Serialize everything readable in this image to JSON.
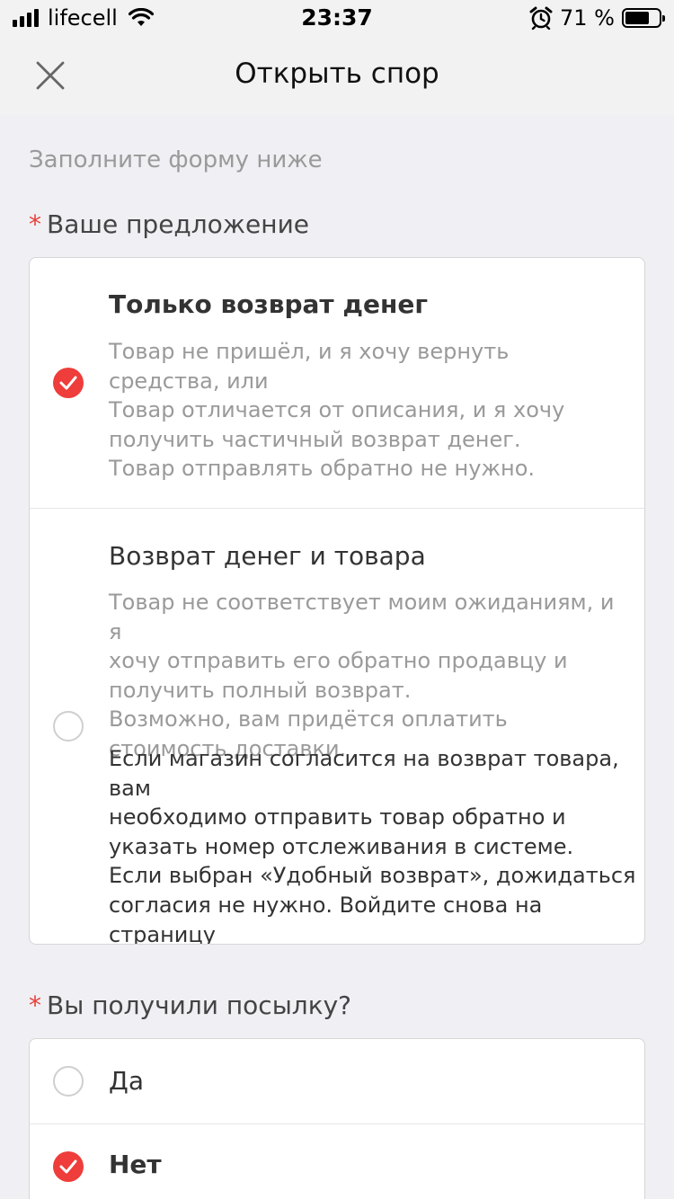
{
  "status_bar": {
    "carrier": "lifecell",
    "time": "23:37",
    "battery": "71 %",
    "battery_level": 0.71,
    "icons": [
      "signal-icon",
      "wifi-icon",
      "alarm-icon",
      "battery-icon"
    ]
  },
  "header": {
    "title": "Открыть спор",
    "close_icon": "close-icon"
  },
  "form": {
    "hint": "Заполните форму ниже",
    "required_mark": "*",
    "proposal": {
      "label": "Ваше предложение",
      "options": [
        {
          "title": "Только возврат денег",
          "description": "Товар не пришёл, и я хочу вернуть\nсредства, или\nТовар отличается от описания, и я хочу\nполучить частичный возврат денег.\nТовар отправлять обратно не нужно.",
          "selected": true
        },
        {
          "title": "Возврат денег и товара",
          "description": "Товар не соответствует моим ожиданиям, и я\nхочу отправить его обратно продавцу и\nполучить полный возврат.\nВозможно, вам придётся оплатить\nстоимость доставки.",
          "note": "Если магазин согласится на возврат товара, вам\nнеобходимо отправить товар обратно и\nуказать номер отслеживания в системе.\nЕсли выбран «Удобный возврат», дожидаться\nсогласия не нужно. Войдите снова на страницу\nспора и нажмите «Вернуть товар».",
          "selected": false
        }
      ]
    },
    "received": {
      "label": "Вы получили посылку?",
      "options": [
        {
          "label": "Да",
          "selected": false
        },
        {
          "label": "Нет",
          "selected": true
        }
      ]
    }
  },
  "colors": {
    "accent": "#ee3d3a",
    "background": "#efeff4",
    "header_bg": "#f2f2f2",
    "muted_text": "#9a9a9a"
  }
}
